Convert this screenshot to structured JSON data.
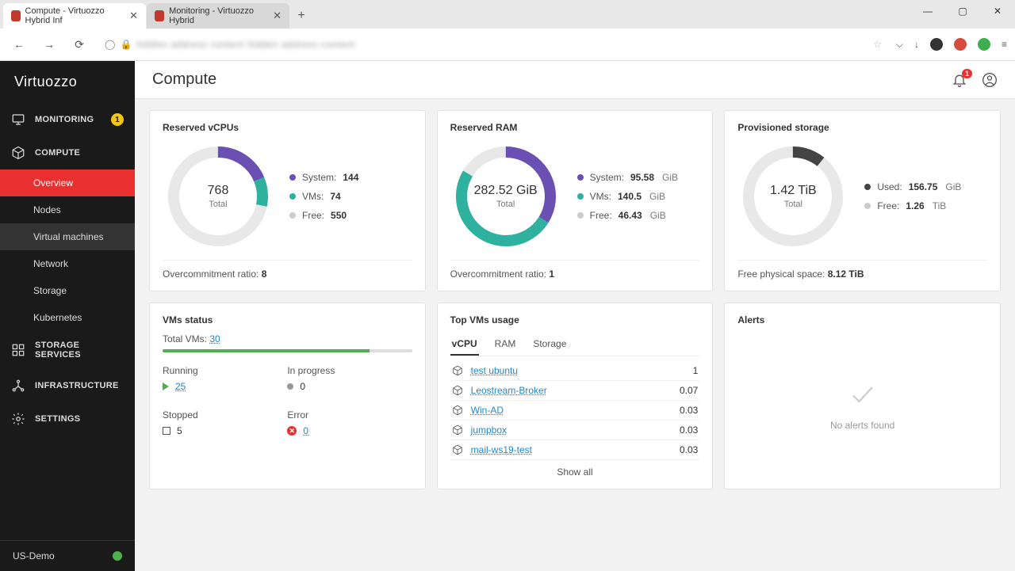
{
  "browser": {
    "tabs": [
      {
        "title": "Compute - Virtuozzo Hybrid Inf",
        "active": true
      },
      {
        "title": "Monitoring - Virtuozzo Hybrid",
        "active": false
      }
    ],
    "win_controls": {
      "min": "—",
      "max": "▢",
      "close": "✕"
    },
    "ext_colors": [
      "#333333",
      "#d84c3e",
      "#3db04d"
    ]
  },
  "sidebar": {
    "logo": "Virtuozzo",
    "items": [
      {
        "label": "MONITORING",
        "icon": "monitor-icon",
        "badge": "1"
      },
      {
        "label": "COMPUTE",
        "icon": "cube-icon",
        "expanded": true,
        "children": [
          {
            "label": "Overview",
            "active": true
          },
          {
            "label": "Nodes"
          },
          {
            "label": "Virtual machines",
            "hover": true
          },
          {
            "label": "Network"
          },
          {
            "label": "Storage"
          },
          {
            "label": "Kubernetes"
          }
        ]
      },
      {
        "label": "STORAGE SERVICES",
        "icon": "storage-icon"
      },
      {
        "label": "INFRASTRUCTURE",
        "icon": "infra-icon"
      },
      {
        "label": "SETTINGS",
        "icon": "gear-icon"
      }
    ],
    "footer": {
      "label": "US-Demo"
    }
  },
  "header": {
    "title": "Compute",
    "bell_count": "1"
  },
  "cards": {
    "vcpu": {
      "title": "Reserved vCPUs",
      "center_value": "768",
      "center_label": "Total",
      "legend": [
        {
          "color": "#6b4fb3",
          "label": "System:",
          "value": "144"
        },
        {
          "color": "#2fb1a0",
          "label": "VMs:",
          "value": "74"
        },
        {
          "color": "#cccccc",
          "label": "Free:",
          "value": "550"
        }
      ],
      "footer_label": "Overcommitment ratio:",
      "footer_value": "8"
    },
    "ram": {
      "title": "Reserved RAM",
      "center_value": "282.52 GiB",
      "center_label": "Total",
      "legend": [
        {
          "color": "#6b4fb3",
          "label": "System:",
          "value": "95.58",
          "unit": "GiB"
        },
        {
          "color": "#2fb1a0",
          "label": "VMs:",
          "value": "140.5",
          "unit": "GiB"
        },
        {
          "color": "#cccccc",
          "label": "Free:",
          "value": "46.43",
          "unit": "GiB"
        }
      ],
      "footer_label": "Overcommitment ratio:",
      "footer_value": "1"
    },
    "storage": {
      "title": "Provisioned storage",
      "center_value": "1.42 TiB",
      "center_label": "Total",
      "legend": [
        {
          "color": "#444444",
          "label": "Used:",
          "value": "156.75",
          "unit": "GiB"
        },
        {
          "color": "#cccccc",
          "label": "Free:",
          "value": "1.26",
          "unit": "TiB"
        }
      ],
      "footer_label": "Free physical space:",
      "footer_value": "8.12 TiB"
    },
    "vms_status": {
      "title": "VMs status",
      "total_label": "Total VMs:",
      "total_value": "30",
      "stats": {
        "running": {
          "label": "Running",
          "value": "25"
        },
        "inprogress": {
          "label": "In progress",
          "value": "0"
        },
        "stopped": {
          "label": "Stopped",
          "value": "5"
        },
        "error": {
          "label": "Error",
          "value": "0"
        }
      }
    },
    "top_vms": {
      "title": "Top VMs usage",
      "tabs": [
        "vCPU",
        "RAM",
        "Storage"
      ],
      "active_tab": 0,
      "rows": [
        {
          "name": "test ubuntu",
          "usage": "1"
        },
        {
          "name": "Leostream-Broker",
          "usage": "0.07"
        },
        {
          "name": "Win-AD",
          "usage": "0.03"
        },
        {
          "name": "jumpbox",
          "usage": "0.03"
        },
        {
          "name": "mail-ws19-test",
          "usage": "0.03"
        }
      ],
      "show_all": "Show all"
    },
    "alerts": {
      "title": "Alerts",
      "empty": "No alerts found"
    }
  },
  "chart_data": [
    {
      "type": "pie",
      "title": "Reserved vCPUs",
      "categories": [
        "System",
        "VMs",
        "Free"
      ],
      "values": [
        144,
        74,
        550
      ],
      "total": 768
    },
    {
      "type": "pie",
      "title": "Reserved RAM",
      "categories": [
        "System",
        "VMs",
        "Free"
      ],
      "values": [
        95.58,
        140.5,
        46.43
      ],
      "total": 282.52,
      "unit": "GiB"
    },
    {
      "type": "pie",
      "title": "Provisioned storage",
      "categories": [
        "Used",
        "Free"
      ],
      "values": [
        156.75,
        1290.24
      ],
      "total": 1454.08,
      "unit": "GiB",
      "display_total": "1.42 TiB"
    }
  ]
}
